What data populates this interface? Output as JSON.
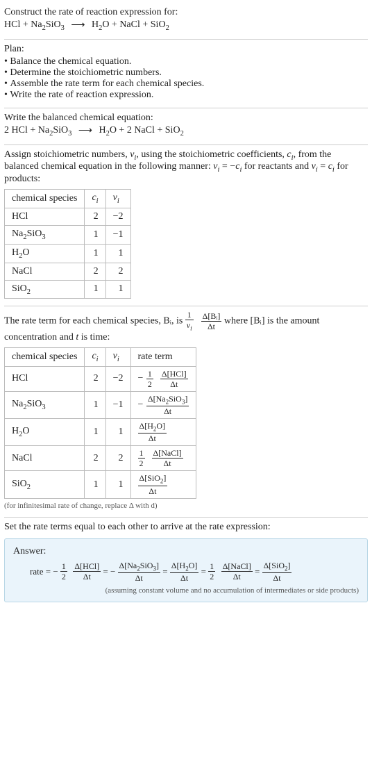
{
  "intro": {
    "line1": "Construct the rate of reaction expression for:",
    "equation_left": "HCl + Na",
    "equation": "HCl + Na₂SiO₃",
    "arrow": "⟶",
    "equation_right": "H₂O + NaCl + SiO₂"
  },
  "plan": {
    "heading": "Plan:",
    "items": [
      "Balance the chemical equation.",
      "Determine the stoichiometric numbers.",
      "Assemble the rate term for each chemical species.",
      "Write the rate of reaction expression."
    ]
  },
  "balanced": {
    "heading": "Write the balanced chemical equation:",
    "left": "2 HCl + Na₂SiO₃",
    "arrow": "⟶",
    "right": "H₂O + 2 NaCl + SiO₂"
  },
  "stoich_intro": "Assign stoichiometric numbers, νᵢ, using the stoichiometric coefficients, cᵢ, from the balanced chemical equation in the following manner: νᵢ = −cᵢ for reactants and νᵢ = cᵢ for products:",
  "table1": {
    "headers": [
      "chemical species",
      "cᵢ",
      "νᵢ"
    ],
    "rows": [
      {
        "sp": "HCl",
        "c": "2",
        "v": "−2"
      },
      {
        "sp": "Na₂SiO₃",
        "c": "1",
        "v": "−1"
      },
      {
        "sp": "H₂O",
        "c": "1",
        "v": "1"
      },
      {
        "sp": "NaCl",
        "c": "2",
        "v": "2"
      },
      {
        "sp": "SiO₂",
        "c": "1",
        "v": "1"
      }
    ]
  },
  "rate_intro_a": "The rate term for each chemical species, Bᵢ, is ",
  "rate_intro_frac1_num": "1",
  "rate_intro_frac1_den": "νᵢ",
  "rate_intro_frac2_num": "Δ[Bᵢ]",
  "rate_intro_frac2_den": "Δt",
  "rate_intro_b": " where [Bᵢ] is the amount concentration and ",
  "rate_intro_c": "t",
  "rate_intro_d": " is time:",
  "table2": {
    "headers": [
      "chemical species",
      "cᵢ",
      "νᵢ",
      "rate term"
    ],
    "rows": [
      {
        "sp": "HCl",
        "c": "2",
        "v": "−2",
        "pre": "−",
        "half_num": "1",
        "half_den": "2",
        "dnum": "Δ[HCl]",
        "dden": "Δt"
      },
      {
        "sp": "Na₂SiO₃",
        "c": "1",
        "v": "−1",
        "pre": "−",
        "half_num": "",
        "half_den": "",
        "dnum": "Δ[Na₂SiO₃]",
        "dden": "Δt"
      },
      {
        "sp": "H₂O",
        "c": "1",
        "v": "1",
        "pre": "",
        "half_num": "",
        "half_den": "",
        "dnum": "Δ[H₂O]",
        "dden": "Δt"
      },
      {
        "sp": "NaCl",
        "c": "2",
        "v": "2",
        "pre": "",
        "half_num": "1",
        "half_den": "2",
        "dnum": "Δ[NaCl]",
        "dden": "Δt"
      },
      {
        "sp": "SiO₂",
        "c": "1",
        "v": "1",
        "pre": "",
        "half_num": "",
        "half_den": "",
        "dnum": "Δ[SiO₂]",
        "dden": "Δt"
      }
    ]
  },
  "table2_note": "(for infinitesimal rate of change, replace Δ with d)",
  "final_intro": "Set the rate terms equal to each other to arrive at the rate expression:",
  "answer": {
    "label": "Answer:",
    "prefix": "rate = −",
    "terms": [
      {
        "half_num": "1",
        "half_den": "2",
        "dnum": "Δ[HCl]",
        "dden": "Δt",
        "neg_after": "= −"
      },
      {
        "half_num": "",
        "half_den": "",
        "dnum": "Δ[Na₂SiO₃]",
        "dden": "Δt",
        "neg_after": "="
      },
      {
        "half_num": "",
        "half_den": "",
        "dnum": "Δ[H₂O]",
        "dden": "Δt",
        "neg_after": "="
      },
      {
        "half_num": "1",
        "half_den": "2",
        "dnum": "Δ[NaCl]",
        "dden": "Δt",
        "neg_after": "="
      },
      {
        "half_num": "",
        "half_den": "",
        "dnum": "Δ[SiO₂]",
        "dden": "Δt",
        "neg_after": ""
      }
    ],
    "note": "(assuming constant volume and no accumulation of intermediates or side products)"
  },
  "chart_data": {
    "type": "table",
    "title": "Stoichiometric numbers and rate terms for HCl + Na2SiO3 → H2O + NaCl + SiO2",
    "species": [
      "HCl",
      "Na2SiO3",
      "H2O",
      "NaCl",
      "SiO2"
    ],
    "c_i": [
      2,
      1,
      1,
      2,
      1
    ],
    "nu_i": [
      -2,
      -1,
      1,
      2,
      1
    ],
    "rate_terms": [
      "-(1/2) d[HCl]/dt",
      "- d[Na2SiO3]/dt",
      "d[H2O]/dt",
      "(1/2) d[NaCl]/dt",
      "d[SiO2]/dt"
    ],
    "rate_expression": "rate = -(1/2) Δ[HCl]/Δt = - Δ[Na2SiO3]/Δt = Δ[H2O]/Δt = (1/2) Δ[NaCl]/Δt = Δ[SiO2]/Δt"
  }
}
